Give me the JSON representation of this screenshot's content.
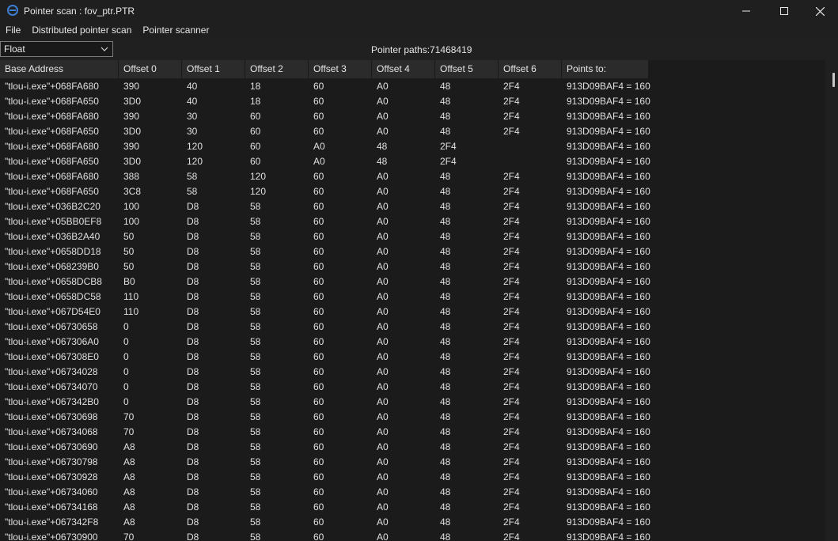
{
  "window": {
    "title": "Pointer scan : fov_ptr.PTR",
    "minimize_icon": "minimize-icon",
    "maximize_icon": "maximize-icon",
    "close_icon": "close-icon"
  },
  "menu": [
    "File",
    "Distributed pointer scan",
    "Pointer scanner"
  ],
  "toolbar": {
    "type_select": "Float",
    "pointer_paths_label": "Pointer paths:71468419"
  },
  "table": {
    "columns": [
      "Base Address",
      "Offset 0",
      "Offset 1",
      "Offset 2",
      "Offset 3",
      "Offset 4",
      "Offset 5",
      "Offset 6",
      "Points to:"
    ],
    "rows": [
      [
        "\"tlou-i.exe\"+068FA680",
        "390",
        "40",
        "18",
        "60",
        "A0",
        "48",
        "2F4",
        "913D09BAF4 = 160"
      ],
      [
        "\"tlou-i.exe\"+068FA650",
        "3D0",
        "40",
        "18",
        "60",
        "A0",
        "48",
        "2F4",
        "913D09BAF4 = 160"
      ],
      [
        "\"tlou-i.exe\"+068FA680",
        "390",
        "30",
        "60",
        "60",
        "A0",
        "48",
        "2F4",
        "913D09BAF4 = 160"
      ],
      [
        "\"tlou-i.exe\"+068FA650",
        "3D0",
        "30",
        "60",
        "60",
        "A0",
        "48",
        "2F4",
        "913D09BAF4 = 160"
      ],
      [
        "\"tlou-i.exe\"+068FA680",
        "390",
        "120",
        "60",
        "A0",
        "48",
        "2F4",
        "",
        "913D09BAF4 = 160"
      ],
      [
        "\"tlou-i.exe\"+068FA650",
        "3D0",
        "120",
        "60",
        "A0",
        "48",
        "2F4",
        "",
        "913D09BAF4 = 160"
      ],
      [
        "\"tlou-i.exe\"+068FA680",
        "388",
        "58",
        "120",
        "60",
        "A0",
        "48",
        "2F4",
        "913D09BAF4 = 160"
      ],
      [
        "\"tlou-i.exe\"+068FA650",
        "3C8",
        "58",
        "120",
        "60",
        "A0",
        "48",
        "2F4",
        "913D09BAF4 = 160"
      ],
      [
        "\"tlou-i.exe\"+036B2C20",
        "100",
        "D8",
        "58",
        "60",
        "A0",
        "48",
        "2F4",
        "913D09BAF4 = 160"
      ],
      [
        "\"tlou-i.exe\"+05BB0EF8",
        "100",
        "D8",
        "58",
        "60",
        "A0",
        "48",
        "2F4",
        "913D09BAF4 = 160"
      ],
      [
        "\"tlou-i.exe\"+036B2A40",
        "50",
        "D8",
        "58",
        "60",
        "A0",
        "48",
        "2F4",
        "913D09BAF4 = 160"
      ],
      [
        "\"tlou-i.exe\"+0658DD18",
        "50",
        "D8",
        "58",
        "60",
        "A0",
        "48",
        "2F4",
        "913D09BAF4 = 160"
      ],
      [
        "\"tlou-i.exe\"+068239B0",
        "50",
        "D8",
        "58",
        "60",
        "A0",
        "48",
        "2F4",
        "913D09BAF4 = 160"
      ],
      [
        "\"tlou-i.exe\"+0658DCB8",
        "B0",
        "D8",
        "58",
        "60",
        "A0",
        "48",
        "2F4",
        "913D09BAF4 = 160"
      ],
      [
        "\"tlou-i.exe\"+0658DC58",
        "110",
        "D8",
        "58",
        "60",
        "A0",
        "48",
        "2F4",
        "913D09BAF4 = 160"
      ],
      [
        "\"tlou-i.exe\"+067D54E0",
        "110",
        "D8",
        "58",
        "60",
        "A0",
        "48",
        "2F4",
        "913D09BAF4 = 160"
      ],
      [
        "\"tlou-i.exe\"+06730658",
        "0",
        "D8",
        "58",
        "60",
        "A0",
        "48",
        "2F4",
        "913D09BAF4 = 160"
      ],
      [
        "\"tlou-i.exe\"+067306A0",
        "0",
        "D8",
        "58",
        "60",
        "A0",
        "48",
        "2F4",
        "913D09BAF4 = 160"
      ],
      [
        "\"tlou-i.exe\"+067308E0",
        "0",
        "D8",
        "58",
        "60",
        "A0",
        "48",
        "2F4",
        "913D09BAF4 = 160"
      ],
      [
        "\"tlou-i.exe\"+06734028",
        "0",
        "D8",
        "58",
        "60",
        "A0",
        "48",
        "2F4",
        "913D09BAF4 = 160"
      ],
      [
        "\"tlou-i.exe\"+06734070",
        "0",
        "D8",
        "58",
        "60",
        "A0",
        "48",
        "2F4",
        "913D09BAF4 = 160"
      ],
      [
        "\"tlou-i.exe\"+067342B0",
        "0",
        "D8",
        "58",
        "60",
        "A0",
        "48",
        "2F4",
        "913D09BAF4 = 160"
      ],
      [
        "\"tlou-i.exe\"+06730698",
        "70",
        "D8",
        "58",
        "60",
        "A0",
        "48",
        "2F4",
        "913D09BAF4 = 160"
      ],
      [
        "\"tlou-i.exe\"+06734068",
        "70",
        "D8",
        "58",
        "60",
        "A0",
        "48",
        "2F4",
        "913D09BAF4 = 160"
      ],
      [
        "\"tlou-i.exe\"+06730690",
        "A8",
        "D8",
        "58",
        "60",
        "A0",
        "48",
        "2F4",
        "913D09BAF4 = 160"
      ],
      [
        "\"tlou-i.exe\"+06730798",
        "A8",
        "D8",
        "58",
        "60",
        "A0",
        "48",
        "2F4",
        "913D09BAF4 = 160"
      ],
      [
        "\"tlou-i.exe\"+06730928",
        "A8",
        "D8",
        "58",
        "60",
        "A0",
        "48",
        "2F4",
        "913D09BAF4 = 160"
      ],
      [
        "\"tlou-i.exe\"+06734060",
        "A8",
        "D8",
        "58",
        "60",
        "A0",
        "48",
        "2F4",
        "913D09BAF4 = 160"
      ],
      [
        "\"tlou-i.exe\"+06734168",
        "A8",
        "D8",
        "58",
        "60",
        "A0",
        "48",
        "2F4",
        "913D09BAF4 = 160"
      ],
      [
        "\"tlou-i.exe\"+067342F8",
        "A8",
        "D8",
        "58",
        "60",
        "A0",
        "48",
        "2F4",
        "913D09BAF4 = 160"
      ],
      [
        "\"tlou-i.exe\"+06730900",
        "70",
        "D8",
        "58",
        "60",
        "A0",
        "48",
        "2F4",
        "913D09BAF4 = 160"
      ]
    ]
  },
  "colors": {
    "background": "#202020",
    "grid_background": "#1b1b1b",
    "header_background": "#2b2b2b",
    "text": "#e0e0e0"
  }
}
